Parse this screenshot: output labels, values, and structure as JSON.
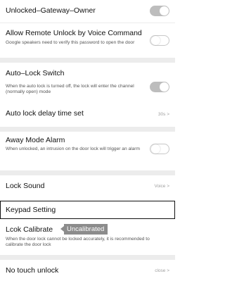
{
  "settings": {
    "unlocked_gateway_owner": {
      "title": "Unlocked–Gateway–Owner",
      "enabled": true
    },
    "remote_unlock_voice": {
      "title": "Allow Remote Unlock by Voice Command",
      "description": "Google speakers need to verify this password to open the door",
      "enabled": false
    },
    "auto_lock_switch": {
      "title": "Auto–Lock Switch",
      "description": "When the auto lock is turned off, the lock will enter the channel (normally open) mode",
      "enabled": true
    },
    "auto_lock_delay": {
      "title": "Auto lock delay time set",
      "value": "30s >"
    },
    "away_mode_alarm": {
      "title": "Away Mode Alarm",
      "description": "When unlocked, an intrusion on the door lock will trigger an alarm",
      "enabled": false
    },
    "lock_sound": {
      "title": "Lock Sound",
      "value": "Voice >"
    },
    "keypad_setting": {
      "title": "Keypad Setting"
    },
    "lock_calibrate": {
      "title": "Lcok Calibrate",
      "badge": "Uncalibrated",
      "description": "When the door lock cannot be locked accurately, it is recommended to calibrate the door lock"
    },
    "no_touch_unlock": {
      "title": "No touch unlock",
      "value": "close >"
    }
  }
}
